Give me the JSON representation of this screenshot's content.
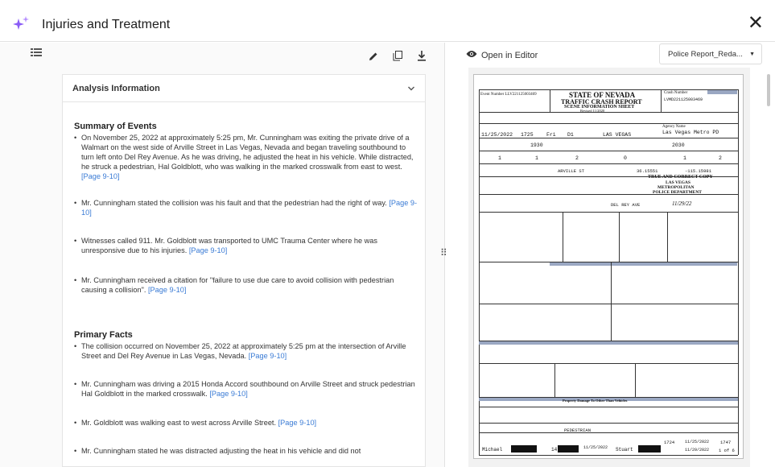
{
  "window": {
    "title": "Injuries and Treatment"
  },
  "icons": {
    "sparkle": "sparkle-icon",
    "close": "close-icon",
    "list": "list-icon",
    "edit": "pencil-icon",
    "copy": "copy-icon",
    "download": "download-icon",
    "eye": "eye-icon",
    "chevron": "chevron-down-icon",
    "grip": "drag-handle-icon"
  },
  "colors": {
    "accent": "#8a5cf6",
    "link": "#3a7bd5"
  },
  "analysis": {
    "header": "Analysis Information",
    "summary_title": "Summary of Events",
    "summary": [
      {
        "text": "On November 25, 2022 at approximately 5:25 pm, Mr. Cunningham was exiting the private drive of a Walmart on the west side of Arville Street in Las Vegas, Nevada and began traveling southbound to turn left onto Del Rey Avenue. As he was driving, he adjusted the heat in his vehicle. While distracted, he struck a pedestrian, Hal Goldblott, who was walking in the marked crosswalk from east to west.",
        "ref": "[Page 9-10]"
      },
      {
        "text": "Mr. Cunningham stated the collision was his fault and that the pedestrian had the right of way.",
        "ref": "[Page 9-10]"
      },
      {
        "text": "Witnesses called 911. Mr. Goldblott was transported to UMC Trauma Center where he was unresponsive due to his injuries.",
        "ref": "[Page 9-10]"
      },
      {
        "text": "Mr. Cunningham received a citation for \"failure to use due care to avoid collision with pedestrian causing a collision\".",
        "ref": "[Page 9-10]"
      }
    ],
    "facts_title": "Primary Facts",
    "facts": [
      {
        "text": "The collision occurred on November 25, 2022 at approximately 5:25 pm at the intersection of Arville Street and Del Rey Avenue in Las Vegas, Nevada.",
        "ref": "[Page 9-10]"
      },
      {
        "text": "Mr. Cunningham was driving a 2015 Honda Accord southbound on Arville Street and struck pedestrian Hal Goldblott in the marked crosswalk.",
        "ref": "[Page 9-10]"
      },
      {
        "text": "Mr. Goldblott was walking east to west across Arville Street.",
        "ref": "[Page 9-10]"
      },
      {
        "text": "Mr. Cunningham stated he was distracted adjusting the heat in his vehicle and did not",
        "ref": ""
      }
    ]
  },
  "viewer": {
    "open_editor": "Open in Editor",
    "document_select": "Police Report_Reda..."
  },
  "report": {
    "event_number": "Event Number LLV221125003469",
    "state": "STATE OF NEVADA",
    "title": "TRAFFIC CRASH REPORT",
    "subtitle": "SCENE INFORMATION SHEET",
    "revised": "Revised 11/2020",
    "crash_number_label": "Crash Number",
    "crash_number": "LVMD221125003469",
    "agency_label": "Agency Name",
    "agency": "Las Vegas Metro PD",
    "crash_date": "11/25/2022",
    "time": "1725",
    "day": "Fri",
    "district": "D1",
    "city": "LAS VEGAS",
    "year": "1930",
    "incident_time": "2030",
    "vehicles": "1",
    "nonmotorists": "1",
    "occupants": "2",
    "fatalities": "0",
    "injured": "1",
    "restrained": "2",
    "street": "ARVILLE ST",
    "latitude": "36.15551",
    "longitude": "-115.15981",
    "stamp1": "TRUE AND CORRECT COPY",
    "stamp2": "LAS VEGAS",
    "stamp3": "METROPOLITAN",
    "stamp4": "POLICE DEPARTMENT",
    "cross_street": "DEL REY AVE",
    "stamp_date": "11/29/22",
    "property_damage": "Property Damage To Other Than Vehicles",
    "pedestrian": "PEDESTRIAN",
    "investigator": "Michael",
    "badge": "14",
    "date_notified": "11/25/2022",
    "time_notified": "1724",
    "arrival_date": "11/25/2022",
    "arrival_time": "1747",
    "reviewer": "Stuart",
    "review_date": "11/29/2022",
    "page": "1 of 6"
  }
}
